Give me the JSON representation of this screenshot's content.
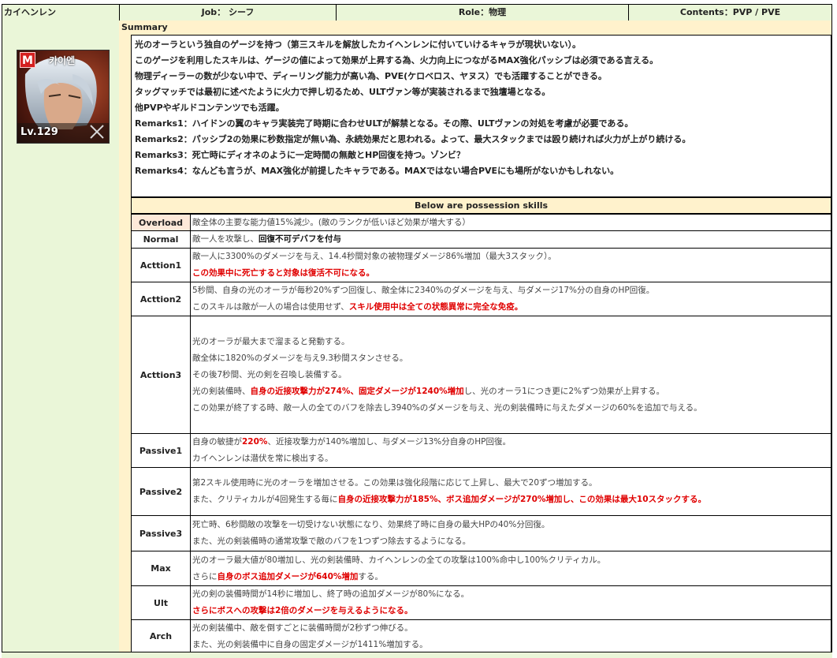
{
  "header": {
    "name": "カイヘンレン",
    "job": "Job： シーフ",
    "role": "Role：物理",
    "contents": "Contents：PVP / PVE"
  },
  "avatar": {
    "badge": "M",
    "name_text": "카이엔",
    "level": "Lv.129"
  },
  "summary": {
    "label": "Summary",
    "lines": [
      "光のオーラという独自のゲージを持つ（第三スキルを解放したカイヘンレンに付いていけるキャラが現状いない）。",
      "このゲージを利用したスキルは、ゲージの値によって効果が上昇する為、火力向上につながるMAX強化パッシブは必須である言える。",
      "物理ディーラーの数が少ない中で、ディーリング能力が高い為、PVE(ケロベロス、ヤヌス）でも活躍することができる。",
      "タッグマッチでは最初に述べたように火力で押し切るため、ULTヴァン等が実装されるまで独壇場となる。",
      "他PVPやギルドコンテンツでも活躍。",
      "Remarks1：ハイドンの翼のキャラ実装完了時期に合わせULTが解禁となる。その際、ULTヴァンの対処を考慮が必要である。",
      "Remarks2：パッシブ2の効果に秒数指定が無い為、永続効果だと思われる。よって、最大スタックまでは殴り続ければ火力が上がり続ける。",
      "Remarks3：死亡時にディオネのように一定時間の無敵とHP回復を持つ。ゾンビ？",
      "Remarks4：なんども言うが、MAX強化が前提したキャラである。MAXではない場合PVEにも場所がないかもしれない。"
    ]
  },
  "skills_header": "Below are possession skills",
  "skills": [
    {
      "name": "Overload",
      "lines": [
        [
          {
            "t": "敵全体の主要な能力値15%減少。(敵のランクが低いほど効果が増大する）",
            "s": ""
          }
        ]
      ]
    },
    {
      "name": "Normal",
      "lines": [
        [
          {
            "t": "敵一人を攻撃し、",
            "s": ""
          },
          {
            "t": "回復不可デバフを付与",
            "s": "blk"
          }
        ]
      ]
    },
    {
      "name": "Acttion1",
      "lines": [
        [
          {
            "t": "敵一人に3300%のダメージを与え、14.4秒間対象の被物理ダメージ86%増加（最大3スタック）。",
            "s": ""
          }
        ],
        [
          {
            "t": "この効果中に死亡すると対象は復活不可になる。",
            "s": "red"
          }
        ]
      ]
    },
    {
      "name": "Acttion2",
      "lines": [
        [
          {
            "t": "5秒間、自身の光のオーラが毎秒20%ずつ回復し、敵全体に2340%のダメージを与え、与ダメージ17%分の自身のHP回復。",
            "s": ""
          }
        ],
        [
          {
            "t": "このスキルは敵が一人の場合は使用せず、",
            "s": ""
          },
          {
            "t": "スキル使用中は全ての状態異常に完全な免疫。",
            "s": "red"
          }
        ]
      ]
    },
    {
      "name": "Acttion3",
      "lines": [
        [
          {
            "t": "光のオーラが最大まで溜まると発動する。",
            "s": ""
          }
        ],
        [
          {
            "t": "敵全体に1820%のダメージを与え9.3秒間スタンさせる。",
            "s": ""
          }
        ],
        [
          {
            "t": "その後7秒間、光の剣を召喚し装備する。",
            "s": ""
          }
        ],
        [
          {
            "t": "光の剣装備時、",
            "s": ""
          },
          {
            "t": "自身の近接攻撃力が274%、固定ダメージが1240%増加",
            "s": "red"
          },
          {
            "t": "し、光のオーラ1につき更に2%ずつ効果が上昇する。",
            "s": ""
          }
        ],
        [
          {
            "t": "この効果が終了する時、敵一人の全てのバフを除去し3940%のダメージを与え、光の剣装備時に与えたダメージの60%を追加で与える。",
            "s": ""
          }
        ]
      ]
    },
    {
      "name": "Passive1",
      "lines": [
        [
          {
            "t": "自身の敏捷が",
            "s": ""
          },
          {
            "t": "220%",
            "s": "red"
          },
          {
            "t": "、近接攻撃力が140%増加し、与ダメージ13%分自身のHP回復。",
            "s": ""
          }
        ],
        [
          {
            "t": "カイヘンレンは潜伏を常に検出する。",
            "s": ""
          }
        ]
      ]
    },
    {
      "name": "Passive2",
      "lines": [
        [
          {
            "t": "第2スキル使用時に光のオーラを増加させる。この効果は強化段階に応じて上昇し、最大で20ずつ増加する。",
            "s": ""
          }
        ],
        [
          {
            "t": "また、クリティカルが4回発生する毎に",
            "s": ""
          },
          {
            "t": "自身の近接攻撃力が185%、ボス追加ダメージが270%増加し、この効果は最大10スタックする。",
            "s": "red"
          }
        ]
      ]
    },
    {
      "name": "Passive3",
      "lines": [
        [
          {
            "t": "死亡時、6秒間敵の攻撃を一切受けない状態になり、効果終了時に自身の最大HPの40%分回復。",
            "s": ""
          }
        ],
        [
          {
            "t": "また、光の剣装備時の通常攻撃で敵のバフを1つずつ除去するようになる。",
            "s": ""
          }
        ]
      ]
    },
    {
      "name": "Max",
      "lines": [
        [
          {
            "t": "光のオーラ最大値が80増加し、光の剣装備時、カイヘンレンの全ての攻撃は100%命中し100%クリティカル。",
            "s": ""
          }
        ],
        [
          {
            "t": "さらに",
            "s": ""
          },
          {
            "t": "自身のボス追加ダメージが640%増加",
            "s": "red"
          },
          {
            "t": "する。",
            "s": ""
          }
        ]
      ]
    },
    {
      "name": "Ult",
      "lines": [
        [
          {
            "t": "光の剣の装備時間が14秒に増加し、終了時の追加ダメージが80%になる。",
            "s": ""
          }
        ],
        [
          {
            "t": "さらにボスへの攻撃は2倍のダメージを与えるようになる。",
            "s": "red"
          }
        ]
      ]
    },
    {
      "name": "Arch",
      "lines": [
        [
          {
            "t": "光の剣装備中、敵を倒すごとに装備時間が2秒ずつ伸びる。",
            "s": ""
          }
        ],
        [
          {
            "t": "また、光の剣装備中に自身の固定ダメージが1411%増加する。",
            "s": ""
          }
        ]
      ]
    }
  ],
  "colors": {
    "green_bg": "#eaf6d8",
    "cream_bg": "#fff2cc",
    "overload_bg": "#fde9d9",
    "highlight_red": "#e00000"
  }
}
